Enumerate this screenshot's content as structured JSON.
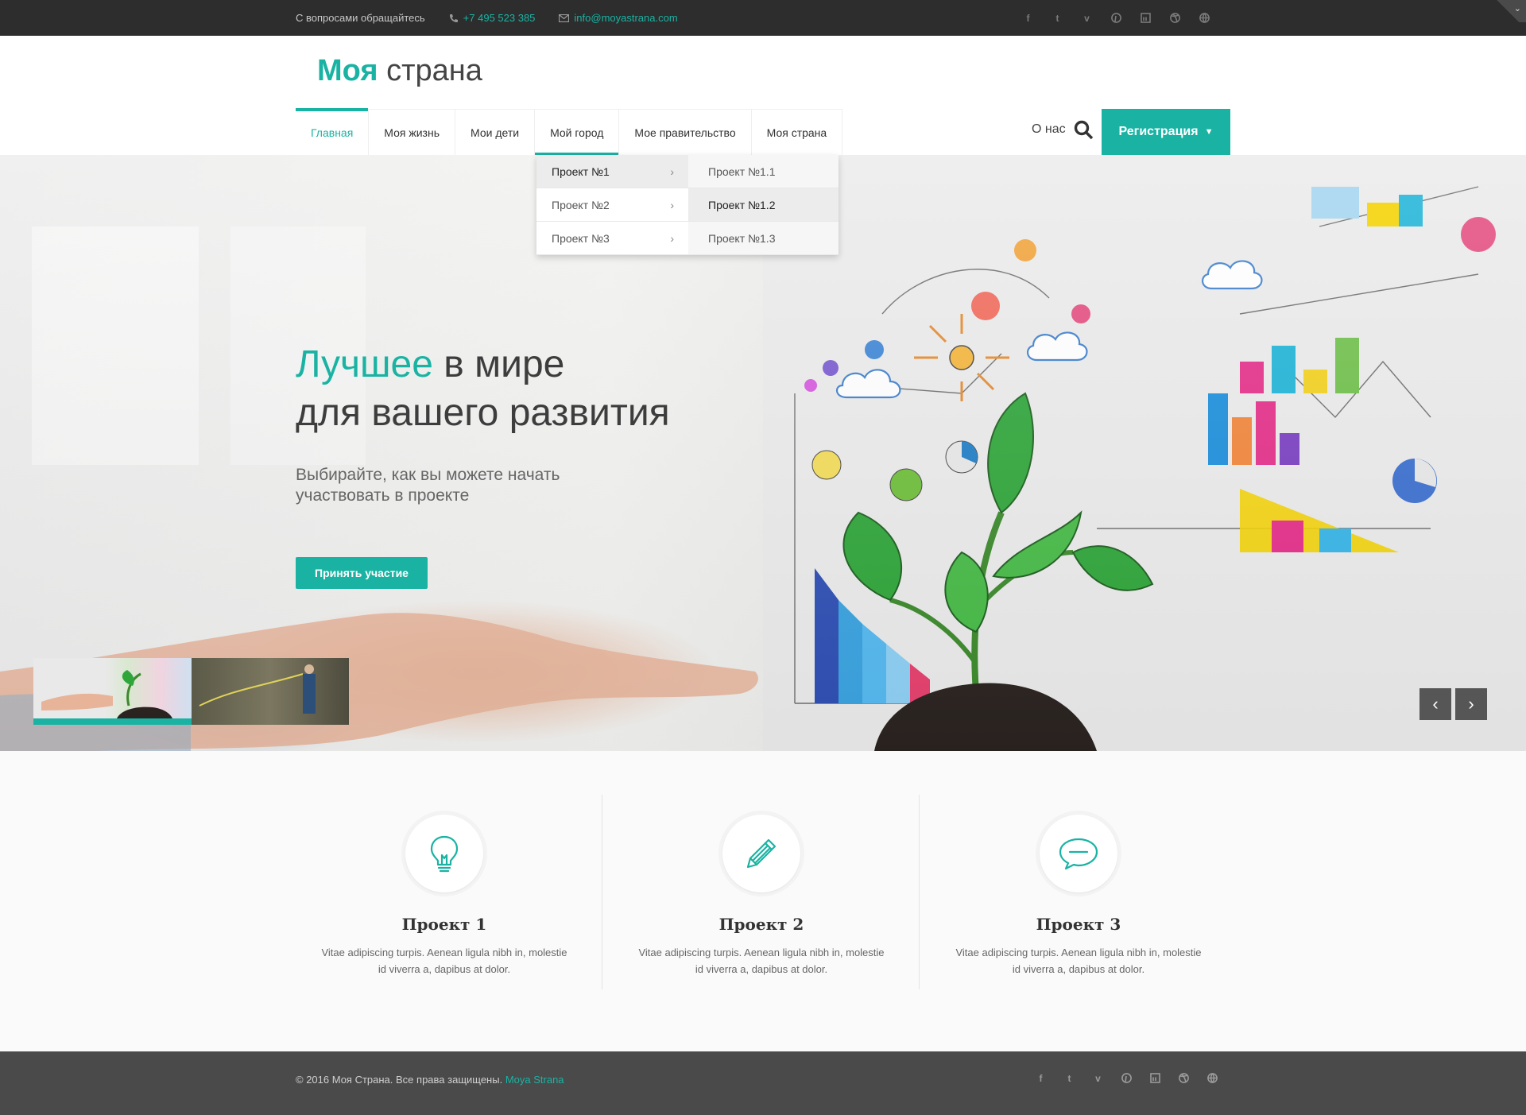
{
  "topbar": {
    "contact_label": "С вопросами обращайтесь",
    "phone": "+7 495 523 385",
    "email": "info@moyastrana.com",
    "social_icons": [
      "facebook-icon",
      "twitter-icon",
      "vimeo-icon",
      "pinterest-icon",
      "linkedin-icon",
      "dribbble-icon",
      "globe-icon"
    ]
  },
  "header": {
    "logo_brand": "Моя",
    "logo_rest": "страна",
    "nav": [
      {
        "label": "Главная",
        "active": true
      },
      {
        "label": "Моя жизнь"
      },
      {
        "label": "Мои дети"
      },
      {
        "label": "Мой город",
        "open": true
      },
      {
        "label": "Мое правительство"
      },
      {
        "label": "Моя страна"
      }
    ],
    "about_label": "О нас",
    "register_label": "Регистрация"
  },
  "dropdown": {
    "items": [
      "Проект №1",
      "Проект №2",
      "Проект №3"
    ],
    "subitems": [
      "Проект №1.1",
      "Проект №1.2",
      "Проект №1.3"
    ]
  },
  "hero": {
    "headline_accent": "Лучшее",
    "headline_rest": " в мире",
    "headline_line2": "для вашего развития",
    "subline": "Выбирайте, как вы можете начать участвовать в проекте",
    "cta_label": "Принять участие",
    "active_slide": 1,
    "slide_count": 2
  },
  "features": [
    {
      "icon": "lightbulb-icon",
      "title": "Проект 1",
      "text": "Vitae adipiscing turpis. Aenean ligula nibh in, molestie id viverra a, dapibus at dolor."
    },
    {
      "icon": "pencil-icon",
      "title": "Проект 2",
      "text": "Vitae adipiscing turpis. Aenean ligula nibh in, molestie id viverra a, dapibus at dolor."
    },
    {
      "icon": "speech-bubble-icon",
      "title": "Проект 3",
      "text": "Vitae adipiscing turpis. Aenean ligula nibh in, molestie id viverra a, dapibus at dolor."
    }
  ],
  "footer": {
    "copyright": "© 2016 Моя Страна. Все права защищены.",
    "brand_link": "Moya Strana"
  },
  "colors": {
    "accent": "#1ab3a3",
    "topbar": "#2d2d2d",
    "footer": "#4a4a4a"
  }
}
